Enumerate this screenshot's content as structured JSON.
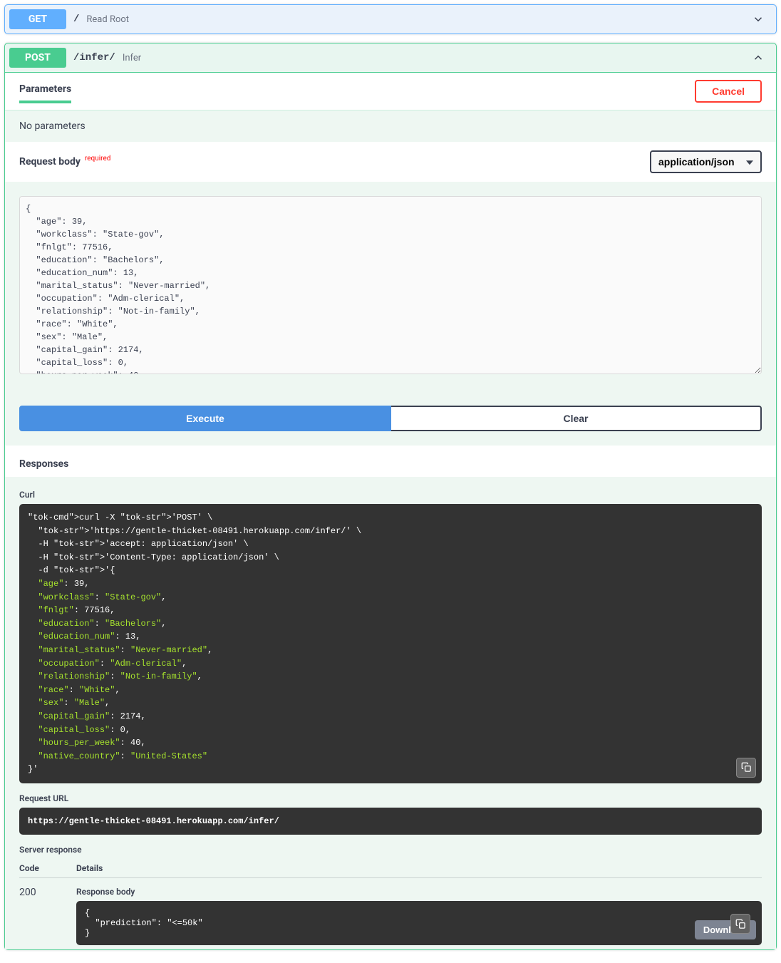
{
  "endpoints": {
    "get": {
      "method": "GET",
      "path": "/",
      "desc": "Read Root"
    },
    "post": {
      "method": "POST",
      "path": "/infer/",
      "desc": "Infer"
    }
  },
  "parameters": {
    "tab_label": "Parameters",
    "cancel_label": "Cancel",
    "empty_msg": "No parameters"
  },
  "request_body": {
    "label": "Request body",
    "required_tag": "required",
    "content_type_selected": "application/json",
    "payload": "{\n  \"age\": 39,\n  \"workclass\": \"State-gov\",\n  \"fnlgt\": 77516,\n  \"education\": \"Bachelors\",\n  \"education_num\": 13,\n  \"marital_status\": \"Never-married\",\n  \"occupation\": \"Adm-clerical\",\n  \"relationship\": \"Not-in-family\",\n  \"race\": \"White\",\n  \"sex\": \"Male\",\n  \"capital_gain\": 2174,\n  \"capital_loss\": 0,\n  \"hours_per_week\": 40,\n  \"native_country\": \"United-States\"\n}"
  },
  "buttons": {
    "execute": "Execute",
    "clear": "Clear"
  },
  "responses": {
    "header": "Responses",
    "curl_label": "Curl",
    "curl_cmd": "curl -X 'POST' \\\n  'https://gentle-thicket-08491.herokuapp.com/infer/' \\\n  -H 'accept: application/json' \\\n  -H 'Content-Type: application/json' \\\n  -d '{\n  \"age\": 39,\n  \"workclass\": \"State-gov\",\n  \"fnlgt\": 77516,\n  \"education\": \"Bachelors\",\n  \"education_num\": 13,\n  \"marital_status\": \"Never-married\",\n  \"occupation\": \"Adm-clerical\",\n  \"relationship\": \"Not-in-family\",\n  \"race\": \"White\",\n  \"sex\": \"Male\",\n  \"capital_gain\": 2174,\n  \"capital_loss\": 0,\n  \"hours_per_week\": 40,\n  \"native_country\": \"United-States\"\n}'",
    "request_url_label": "Request URL",
    "request_url": "https://gentle-thicket-08491.herokuapp.com/infer/",
    "server_response_label": "Server response",
    "col_code": "Code",
    "col_details": "Details",
    "code_value": "200",
    "response_body_label": "Response body",
    "response_body": "{\n  \"prediction\": \"<=50k\"\n}",
    "download_label": "Download"
  }
}
